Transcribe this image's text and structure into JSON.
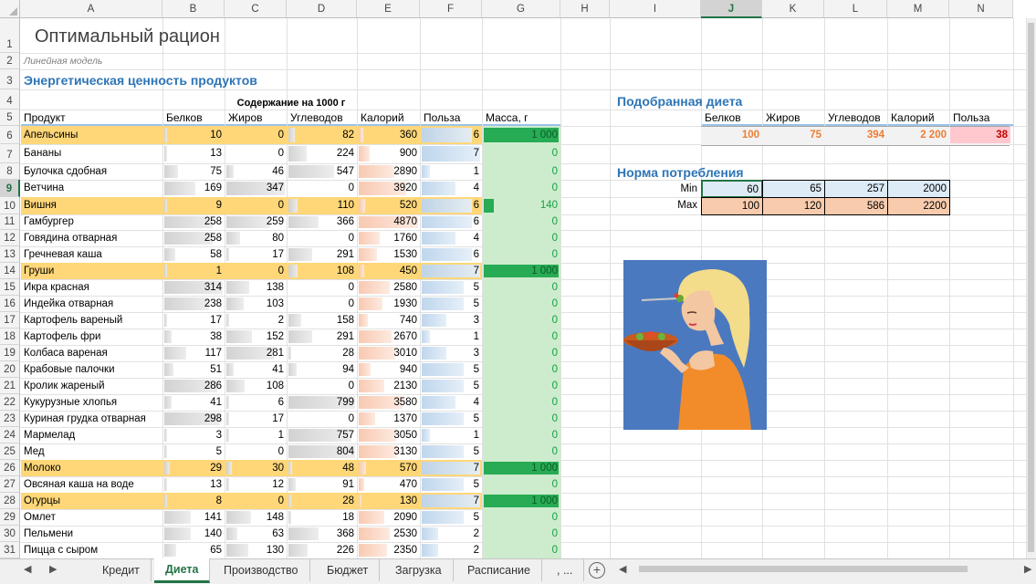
{
  "columns": [
    "A",
    "B",
    "C",
    "D",
    "E",
    "F",
    "G",
    "H",
    "I",
    "J",
    "K",
    "L",
    "M",
    "N"
  ],
  "rows": [
    "1",
    "2",
    "3",
    "4",
    "5",
    "6",
    "7",
    "8",
    "9",
    "10",
    "11",
    "12",
    "13",
    "14",
    "15",
    "16",
    "17",
    "18",
    "19",
    "20",
    "21",
    "22",
    "23",
    "24",
    "25",
    "26",
    "27",
    "28",
    "29",
    "30",
    "31"
  ],
  "title": "Оптимальный рацион",
  "subtitle": "Линейная модель",
  "section_heading": "Энергетическая ценность продуктов",
  "content_label": "Содержание на 1000 г",
  "table_headers": [
    "Продукт",
    "Белков",
    "Жиров",
    "Углеводов",
    "Калорий",
    "Польза",
    "Масса, г"
  ],
  "products": [
    {
      "name": "Апельсины",
      "protein": 10,
      "fat": 0,
      "carbs": 82,
      "cal": 360,
      "benefit": 6,
      "mass": "1 000",
      "selected": true
    },
    {
      "name": "Бананы",
      "protein": 13,
      "fat": 0,
      "carbs": 224,
      "cal": 900,
      "benefit": 7,
      "mass": "0",
      "selected": false
    },
    {
      "name": "Булочка сдобная",
      "protein": 75,
      "fat": 46,
      "carbs": 547,
      "cal": 2890,
      "benefit": 1,
      "mass": "0",
      "selected": false
    },
    {
      "name": "Ветчина",
      "protein": 169,
      "fat": 347,
      "carbs": 0,
      "cal": 3920,
      "benefit": 4,
      "mass": "0",
      "selected": false
    },
    {
      "name": "Вишня",
      "protein": 9,
      "fat": 0,
      "carbs": 110,
      "cal": 520,
      "benefit": 6,
      "mass": "140",
      "selected": true
    },
    {
      "name": "Гамбургер",
      "protein": 258,
      "fat": 259,
      "carbs": 366,
      "cal": 4870,
      "benefit": 6,
      "mass": "0",
      "selected": false
    },
    {
      "name": "Говядина отварная",
      "protein": 258,
      "fat": 80,
      "carbs": 0,
      "cal": 1760,
      "benefit": 4,
      "mass": "0",
      "selected": false
    },
    {
      "name": "Гречневая каша",
      "protein": 58,
      "fat": 17,
      "carbs": 291,
      "cal": 1530,
      "benefit": 6,
      "mass": "0",
      "selected": false
    },
    {
      "name": "Груши",
      "protein": 1,
      "fat": 0,
      "carbs": 108,
      "cal": 450,
      "benefit": 7,
      "mass": "1 000",
      "selected": true
    },
    {
      "name": "Икра красная",
      "protein": 314,
      "fat": 138,
      "carbs": 0,
      "cal": 2580,
      "benefit": 5,
      "mass": "0",
      "selected": false
    },
    {
      "name": "Индейка отварная",
      "protein": 238,
      "fat": 103,
      "carbs": 0,
      "cal": 1930,
      "benefit": 5,
      "mass": "0",
      "selected": false
    },
    {
      "name": "Картофель вареный",
      "protein": 17,
      "fat": 2,
      "carbs": 158,
      "cal": 740,
      "benefit": 3,
      "mass": "0",
      "selected": false
    },
    {
      "name": "Картофель фри",
      "protein": 38,
      "fat": 152,
      "carbs": 291,
      "cal": 2670,
      "benefit": 1,
      "mass": "0",
      "selected": false
    },
    {
      "name": "Колбаса вареная",
      "protein": 117,
      "fat": 281,
      "carbs": 28,
      "cal": 3010,
      "benefit": 3,
      "mass": "0",
      "selected": false
    },
    {
      "name": "Крабовые палочки",
      "protein": 51,
      "fat": 41,
      "carbs": 94,
      "cal": 940,
      "benefit": 5,
      "mass": "0",
      "selected": false
    },
    {
      "name": "Кролик жареный",
      "protein": 286,
      "fat": 108,
      "carbs": 0,
      "cal": 2130,
      "benefit": 5,
      "mass": "0",
      "selected": false
    },
    {
      "name": "Кукурузные хлопья",
      "protein": 41,
      "fat": 6,
      "carbs": 799,
      "cal": 3580,
      "benefit": 4,
      "mass": "0",
      "selected": false
    },
    {
      "name": "Куриная грудка отварная",
      "protein": 298,
      "fat": 17,
      "carbs": 0,
      "cal": 1370,
      "benefit": 5,
      "mass": "0",
      "selected": false
    },
    {
      "name": "Мармелад",
      "protein": 3,
      "fat": 1,
      "carbs": 757,
      "cal": 3050,
      "benefit": 1,
      "mass": "0",
      "selected": false
    },
    {
      "name": "Мед",
      "protein": 5,
      "fat": 0,
      "carbs": 804,
      "cal": 3130,
      "benefit": 5,
      "mass": "0",
      "selected": false
    },
    {
      "name": "Молоко",
      "protein": 29,
      "fat": 30,
      "carbs": 48,
      "cal": 570,
      "benefit": 7,
      "mass": "1 000",
      "selected": true
    },
    {
      "name": "Овсяная каша на воде",
      "protein": 13,
      "fat": 12,
      "carbs": 91,
      "cal": 470,
      "benefit": 5,
      "mass": "0",
      "selected": false
    },
    {
      "name": "Огурцы",
      "protein": 8,
      "fat": 0,
      "carbs": 28,
      "cal": 130,
      "benefit": 7,
      "mass": "1 000",
      "selected": true
    },
    {
      "name": "Омлет",
      "protein": 141,
      "fat": 148,
      "carbs": 18,
      "cal": 2090,
      "benefit": 5,
      "mass": "0",
      "selected": false
    },
    {
      "name": "Пельмени",
      "protein": 140,
      "fat": 63,
      "carbs": 368,
      "cal": 2530,
      "benefit": 2,
      "mass": "0",
      "selected": false
    },
    {
      "name": "Пицца с сыром",
      "protein": 65,
      "fat": 130,
      "carbs": 226,
      "cal": 2350,
      "benefit": 2,
      "mass": "0",
      "selected": false
    }
  ],
  "bar_max": {
    "protein": 314,
    "fat": 347,
    "carbs": 804,
    "cal": 4870,
    "benefit": 7,
    "mass": 1000
  },
  "diet": {
    "heading": "Подобранная диета",
    "headers": [
      "Белков",
      "Жиров",
      "Углеводов",
      "Калорий",
      "Польза"
    ],
    "values": [
      "100",
      "75",
      "394",
      "2 200",
      "38"
    ]
  },
  "norm": {
    "heading": "Норма потребления",
    "min_label": "Min",
    "max_label": "Max",
    "min": [
      "60",
      "65",
      "257",
      "2000"
    ],
    "max": [
      "100",
      "120",
      "586",
      "2200"
    ]
  },
  "tabs": [
    "Кредит",
    "Диета",
    "Производство",
    "Бюджет",
    "Загрузка",
    "Расписание",
    ", ..."
  ],
  "active_tab": "Диета",
  "selected_cell": "J9",
  "picture": "woman-eating-salad-illustration",
  "colors": {
    "highlight": "#ffd779",
    "accent": "#217346",
    "heading": "#2e75b6",
    "mass_bg": "#cdeccd",
    "mass_bar": "#1ea84d"
  }
}
